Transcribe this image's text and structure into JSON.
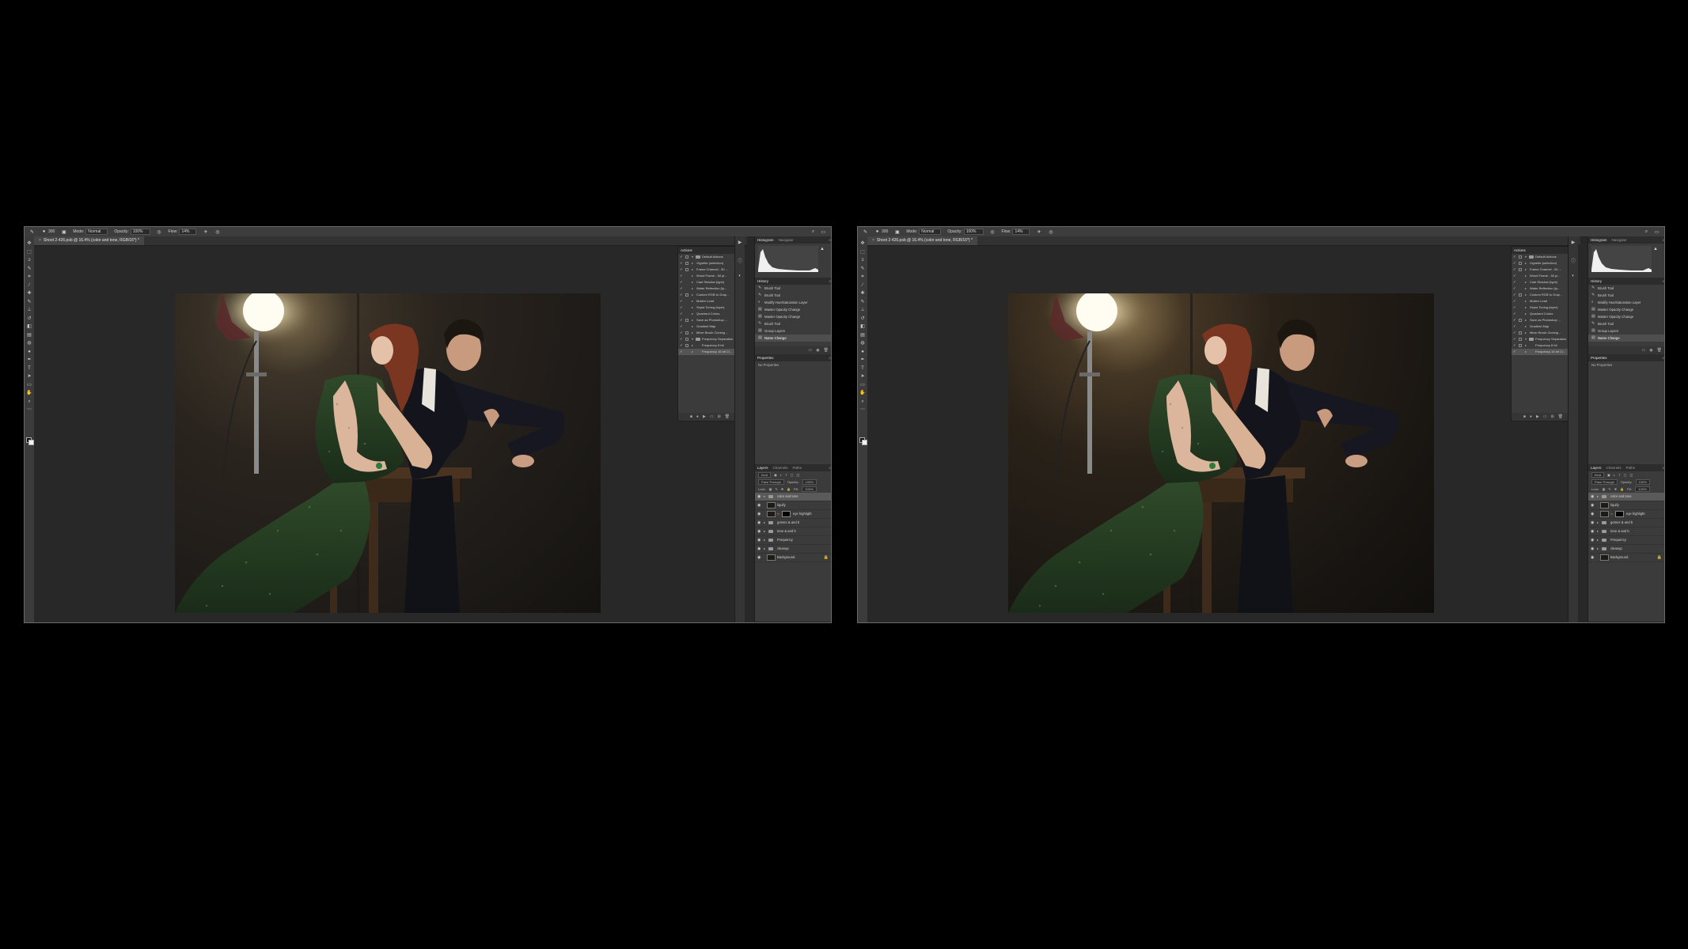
{
  "window": {
    "doc_tab_left": "Shoot 2-426.psb @ 16.4% (color and tone, RGB/16*) *",
    "doc_tab_right": "Shoot 2-426.psb @ 16.4% (color and tone, RGB/16*) *"
  },
  "options_bar": {
    "brush_size": "300",
    "mode_label": "Mode:",
    "mode_value": "Normal",
    "opacity_label": "Opacity:",
    "opacity_value": "100%",
    "flow_label": "Flow:",
    "flow_value": "14%"
  },
  "actions_panel": {
    "title": "Actions",
    "rows": [
      {
        "label": "Default Actions",
        "kind": "set",
        "checked": true,
        "box": true
      },
      {
        "label": "Vignette (selection)",
        "kind": "item",
        "checked": true,
        "box": true
      },
      {
        "label": "Frame Channel - 50 ...",
        "kind": "item",
        "checked": true,
        "box": true
      },
      {
        "label": "Wood Frame - 50 pi...",
        "kind": "item",
        "checked": true,
        "box": false
      },
      {
        "label": "Cast Shadow (type)",
        "kind": "item",
        "checked": true,
        "box": false
      },
      {
        "label": "Water Reflection (ty...",
        "kind": "item",
        "checked": true,
        "box": false
      },
      {
        "label": "Custom RGB to Gray...",
        "kind": "item",
        "checked": true,
        "box": true
      },
      {
        "label": "Molten Lead",
        "kind": "item",
        "checked": true,
        "box": false
      },
      {
        "label": "Sepia Toning (layer)",
        "kind": "item",
        "checked": true,
        "box": false
      },
      {
        "label": "Quadrant Colors",
        "kind": "item",
        "checked": true,
        "box": false
      },
      {
        "label": "Save as Photoshop ...",
        "kind": "item",
        "checked": true,
        "box": true
      },
      {
        "label": "Gradient Map",
        "kind": "item",
        "checked": true,
        "box": false
      },
      {
        "label": "Mixer Brush Cloning ...",
        "kind": "item",
        "checked": true,
        "box": true
      },
      {
        "label": "Frequency Separation",
        "kind": "set",
        "checked": true,
        "box": true
      },
      {
        "label": "Frequency 8 bit",
        "kind": "sub",
        "checked": true,
        "box": true,
        "suffix": "F8"
      },
      {
        "label": "Frequency 16 bit Cl...",
        "kind": "sub",
        "checked": true,
        "box": false,
        "suffix": "F9",
        "selected": true
      }
    ]
  },
  "histogram_panel": {
    "tabs": [
      "Histogram",
      "Navigator"
    ],
    "active": "Histogram"
  },
  "history_panel": {
    "title": "History",
    "rows": [
      {
        "label": "Brush Tool",
        "icon": "brush"
      },
      {
        "label": "Brush Tool",
        "icon": "brush"
      },
      {
        "label": "Modify Hue/Saturation Layer",
        "icon": "adjust"
      },
      {
        "label": "Master Opacity Change",
        "icon": "layer"
      },
      {
        "label": "Master Opacity Change",
        "icon": "layer"
      },
      {
        "label": "Brush Tool",
        "icon": "brush"
      },
      {
        "label": "Group Layers",
        "icon": "layer"
      },
      {
        "label": "Name Change",
        "icon": "layer",
        "selected": true
      }
    ]
  },
  "properties_panel": {
    "title": "Properties",
    "empty_text": "No Properties"
  },
  "layers_panel": {
    "tabs": [
      "Layers",
      "Channels",
      "Paths"
    ],
    "active": "Layers",
    "kind_label": "Kind",
    "blend_mode": "Pass Through",
    "opacity_label": "Opacity:",
    "opacity_value": "100%",
    "lock_label": "Lock:",
    "fill_label": "Fill:",
    "fill_value": "100%",
    "layers": [
      {
        "name": "color and tone",
        "type": "group",
        "selected": true
      },
      {
        "name": "liquify",
        "type": "pixel"
      },
      {
        "name": "eye highlight",
        "type": "masked"
      },
      {
        "name": "gomez & and b",
        "type": "group"
      },
      {
        "name": "tone & and b",
        "type": "group"
      },
      {
        "name": "Frequency",
        "type": "group"
      },
      {
        "name": "cleanup",
        "type": "group"
      },
      {
        "name": "Background",
        "type": "pixel",
        "locked": true
      }
    ]
  },
  "colors": {
    "app_bg": "#282828",
    "panel_bg": "#3b3b3b",
    "selected_row": "#5a5a5a"
  }
}
